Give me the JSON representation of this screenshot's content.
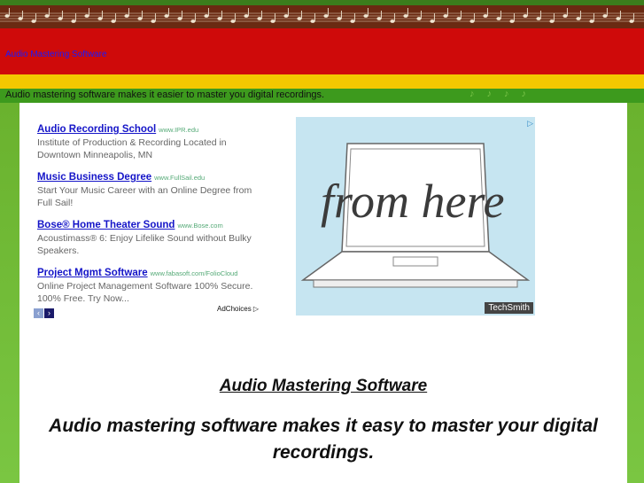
{
  "header": {
    "site_title": "Audio Mastering Software",
    "tagline": "Audio mastering software makes it easier to master you digital recordings."
  },
  "ads": [
    {
      "title": "Audio Recording School",
      "url": "www.IPR.edu",
      "text": "Institute of Production & Recording Located in Downtown Minneapolis, MN"
    },
    {
      "title": "Music Business Degree",
      "url": "www.FullSail.edu",
      "text": "Start Your Music Career with an Online Degree from Full Sail!"
    },
    {
      "title": "Bose® Home Theater Sound",
      "url": "www.Bose.com",
      "text": "Acoustimass® 6: Enjoy Lifelike Sound without Bulky Speakers."
    },
    {
      "title": "Project Mgmt Software",
      "url": "www.fabasoft.com/FolioCloud",
      "text": "Online Project Management Software 100% Secure. 100% Free. Try Now..."
    }
  ],
  "ad_nav": {
    "prev": "‹",
    "next": "›",
    "adchoices": "AdChoices ▷"
  },
  "banner": {
    "text": "from here",
    "brand": "TechSmith",
    "ad_marker": "▷"
  },
  "main": {
    "heading": "Audio Mastering Software",
    "subheading": "Audio mastering software makes it easy to master your digital recordings."
  },
  "colors": {
    "red": "#cf0a0a",
    "yellow": "#f3c800",
    "green": "#3d9a1d",
    "link": "#1515c8"
  }
}
